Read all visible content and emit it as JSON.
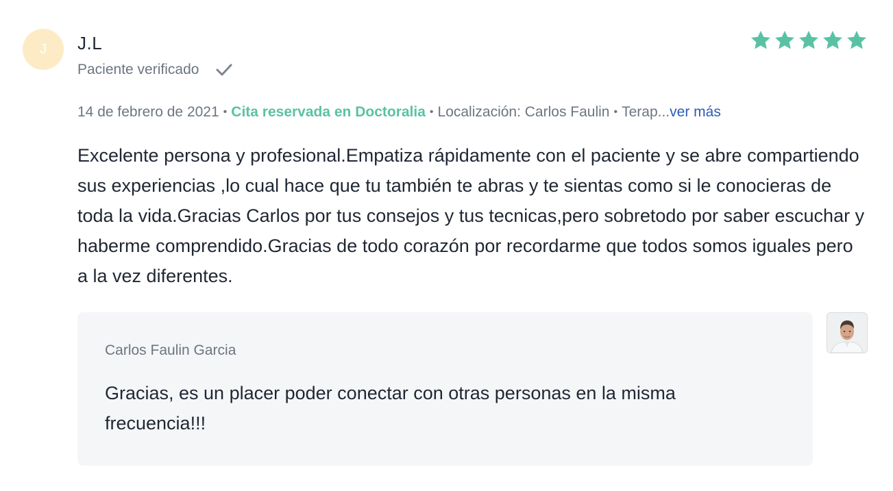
{
  "review": {
    "avatar_initial": "J",
    "author_name": "J.L",
    "verified_label": "Paciente verificado",
    "rating": 5,
    "rating_max": 5,
    "date": "14 de febrero de 2021",
    "separator": "•",
    "booked_label": "Cita reservada en Doctoralia",
    "location_label": "Localización: Carlos Faulin",
    "extra_label": "Terap...",
    "more_link": "ver más",
    "text": "Excelente persona y profesional.Empatiza rápidamente con el paciente y se abre compartiendo sus experiencias ,lo cual hace que tu también te abras y te sientas como si le conocieras de toda la vida.Gracias Carlos por tus consejos y tus tecnicas,pero sobretodo por saber escuchar y haberme comprendido.Gracias de todo corazón por recordarme que todos somos iguales pero a la vez diferentes."
  },
  "reply": {
    "author": "Carlos Faulin Garcia",
    "text": "Gracias, es un placer poder conectar con otras personas en la misma frecuencia!!!"
  },
  "icons": {
    "check": "check-icon",
    "star": "star-icon",
    "doctor_photo": "doctor-avatar"
  },
  "colors": {
    "star": "#5ac2a4",
    "booked": "#5ac2a4",
    "link": "#2a5ab8",
    "avatar_bg": "#fcebc5",
    "reply_bg": "#f5f6f8"
  }
}
